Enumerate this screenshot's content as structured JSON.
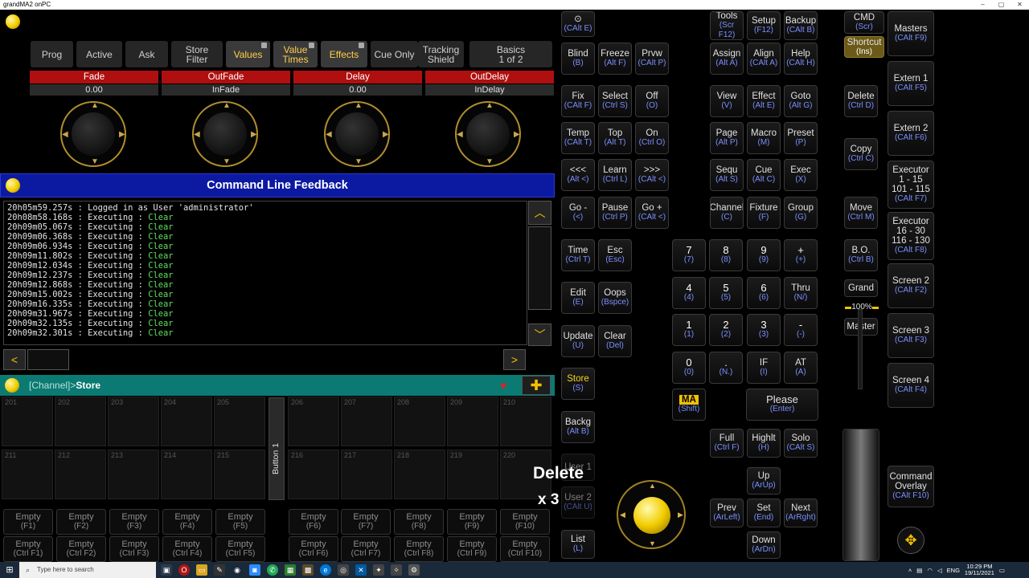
{
  "window": {
    "title": "grandMA2 onPC",
    "minimize": "–",
    "maximize": "▢",
    "close": "✕"
  },
  "toolbar": {
    "tabs": [
      {
        "label": "Prog"
      },
      {
        "label": "Active"
      },
      {
        "label": "Ask"
      },
      {
        "label": "Store Filter"
      },
      {
        "label": "Values"
      },
      {
        "label": "Value Times"
      },
      {
        "label": "Effects"
      },
      {
        "label": "Cue Only"
      },
      {
        "label": "Tracking Shield"
      },
      {
        "label": "Basics 1 of 2"
      }
    ]
  },
  "encoders": [
    {
      "name": "Fade",
      "value": "0.00"
    },
    {
      "name": "OutFade",
      "value": "InFade"
    },
    {
      "name": "Delay",
      "value": "0.00"
    },
    {
      "name": "OutDelay",
      "value": "InDelay"
    }
  ],
  "command_line": {
    "title": "Command Line Feedback",
    "lines": [
      {
        "time": "20h05m59.257s",
        "text": ": Logged in as User 'administrator'",
        "cmd": ""
      },
      {
        "time": "20h08m58.168s",
        "text": ": Executing :",
        "cmd": "Clear"
      },
      {
        "time": "20h09m05.067s",
        "text": ": Executing :",
        "cmd": "Clear"
      },
      {
        "time": "20h09m06.368s",
        "text": ": Executing :",
        "cmd": "Clear"
      },
      {
        "time": "20h09m06.934s",
        "text": ": Executing :",
        "cmd": "Clear"
      },
      {
        "time": "20h09m11.802s",
        "text": ": Executing :",
        "cmd": "Clear"
      },
      {
        "time": "20h09m12.034s",
        "text": ": Executing :",
        "cmd": "Clear"
      },
      {
        "time": "20h09m12.237s",
        "text": ": Executing :",
        "cmd": "Clear"
      },
      {
        "time": "20h09m12.868s",
        "text": ": Executing :",
        "cmd": "Clear"
      },
      {
        "time": "20h09m15.002s",
        "text": ": Executing :",
        "cmd": "Clear"
      },
      {
        "time": "20h09m16.335s",
        "text": ": Executing :",
        "cmd": "Clear"
      },
      {
        "time": "20h09m31.967s",
        "text": ": Executing :",
        "cmd": "Clear"
      },
      {
        "time": "20h09m32.135s",
        "text": ": Executing :",
        "cmd": "Clear"
      },
      {
        "time": "20h09m32.301s",
        "text": ": Executing :",
        "cmd": "Clear"
      }
    ]
  },
  "channel_sheet": {
    "prefix": "[Channel]>",
    "command": "Store",
    "row1": [
      "201",
      "202",
      "203",
      "204",
      "205",
      "206",
      "207",
      "208",
      "209",
      "210"
    ],
    "row2": [
      "211",
      "212",
      "213",
      "214",
      "215",
      "216",
      "217",
      "218",
      "219",
      "220"
    ],
    "side_button": "Button 1"
  },
  "fkeys": {
    "top": [
      {
        "m": "Empty",
        "s": "(F1)"
      },
      {
        "m": "Empty",
        "s": "(F2)"
      },
      {
        "m": "Empty",
        "s": "(F3)"
      },
      {
        "m": "Empty",
        "s": "(F4)"
      },
      {
        "m": "Empty",
        "s": "(F5)"
      },
      {
        "m": "Empty",
        "s": "(F6)"
      },
      {
        "m": "Empty",
        "s": "(F7)"
      },
      {
        "m": "Empty",
        "s": "(F8)"
      },
      {
        "m": "Empty",
        "s": "(F9)"
      },
      {
        "m": "Empty",
        "s": "(F10)"
      }
    ],
    "bottom": [
      {
        "m": "Empty",
        "s": "(Ctrl F1)"
      },
      {
        "m": "Empty",
        "s": "(Ctrl F2)"
      },
      {
        "m": "Empty",
        "s": "(Ctrl F3)"
      },
      {
        "m": "Empty",
        "s": "(Ctrl F4)"
      },
      {
        "m": "Empty",
        "s": "(Ctrl F5)"
      },
      {
        "m": "Empty",
        "s": "(Ctrl F6)"
      },
      {
        "m": "Empty",
        "s": "(Ctrl F7)"
      },
      {
        "m": "Empty",
        "s": "(Ctrl F8)"
      },
      {
        "m": "Empty",
        "s": "(Ctrl F9)"
      },
      {
        "m": "Empty",
        "s": "(Ctrl F10)"
      }
    ]
  },
  "overlay": {
    "key": "Delete",
    "count": "x 3"
  },
  "keys": {
    "cursor": {
      "m": "⊙",
      "s": "(CAlt E)"
    },
    "blind": {
      "m": "Blind",
      "s": "(B)"
    },
    "freeze": {
      "m": "Freeze",
      "s": "(Alt F)"
    },
    "prvw": {
      "m": "Prvw",
      "s": "(CAlt P)"
    },
    "fix": {
      "m": "Fix",
      "s": "(CAlt F)"
    },
    "select": {
      "m": "Select",
      "s": "(Ctrl S)"
    },
    "off": {
      "m": "Off",
      "s": "(O)"
    },
    "temp": {
      "m": "Temp",
      "s": "(CAlt T)"
    },
    "top": {
      "m": "Top",
      "s": "(Alt T)"
    },
    "on": {
      "m": "On",
      "s": "(Ctrl O)"
    },
    "back3": {
      "m": "<<<",
      "s": "(Alt <)"
    },
    "learn": {
      "m": "Learn",
      "s": "(Ctrl L)"
    },
    "fwd3": {
      "m": ">>>",
      "s": "(CAlt <)"
    },
    "gominus": {
      "m": "Go -",
      "s": "(<)"
    },
    "pause": {
      "m": "Pause",
      "s": "(Ctrl P)"
    },
    "goplus": {
      "m": "Go +",
      "s": "(CAlt <)"
    },
    "time": {
      "m": "Time",
      "s": "(Ctrl T)"
    },
    "esc": {
      "m": "Esc",
      "s": "(Esc)"
    },
    "edit": {
      "m": "Edit",
      "s": "(E)"
    },
    "oops": {
      "m": "Oops",
      "s": "(Bspce)"
    },
    "update": {
      "m": "Update",
      "s": "(U)"
    },
    "clear": {
      "m": "Clear",
      "s": "(Del)"
    },
    "store": {
      "m": "Store",
      "s": "(S)"
    },
    "backg": {
      "m": "Backg",
      "s": "(Alt B)"
    },
    "user1": {
      "m": "User 1",
      "s": ""
    },
    "user2": {
      "m": "User 2",
      "s": "(CAlt U)"
    },
    "list": {
      "m": "List",
      "s": "(L)"
    },
    "tools": {
      "m": "Tools",
      "s": "(Scr F12)"
    },
    "setup": {
      "m": "Setup",
      "s": "(F12)"
    },
    "backup": {
      "m": "Backup",
      "s": "(CAlt B)"
    },
    "assign": {
      "m": "Assign",
      "s": "(Alt A)"
    },
    "align": {
      "m": "Align",
      "s": "(CAlt A)"
    },
    "help": {
      "m": "Help",
      "s": "(CAlt H)"
    },
    "view": {
      "m": "View",
      "s": "(V)"
    },
    "effect": {
      "m": "Effect",
      "s": "(Alt E)"
    },
    "goto": {
      "m": "Goto",
      "s": "(Alt G)"
    },
    "page": {
      "m": "Page",
      "s": "(Alt P)"
    },
    "macro": {
      "m": "Macro",
      "s": "(M)"
    },
    "preset": {
      "m": "Preset",
      "s": "(P)"
    },
    "sequ": {
      "m": "Sequ",
      "s": "(Alt S)"
    },
    "cue": {
      "m": "Cue",
      "s": "(Alt C)"
    },
    "exec": {
      "m": "Exec",
      "s": "(X)"
    },
    "channel": {
      "m": "Channel",
      "s": "(C)"
    },
    "fixture": {
      "m": "Fixture",
      "s": "(F)"
    },
    "group": {
      "m": "Group",
      "s": "(G)"
    },
    "n7": {
      "m": "7",
      "s": "(7)"
    },
    "n8": {
      "m": "8",
      "s": "(8)"
    },
    "n9": {
      "m": "9",
      "s": "(9)"
    },
    "plus": {
      "m": "+",
      "s": "(+)"
    },
    "n4": {
      "m": "4",
      "s": "(4)"
    },
    "n5": {
      "m": "5",
      "s": "(5)"
    },
    "n6": {
      "m": "6",
      "s": "(6)"
    },
    "thru": {
      "m": "Thru",
      "s": "(N/)"
    },
    "n1": {
      "m": "1",
      "s": "(1)"
    },
    "n2": {
      "m": "2",
      "s": "(2)"
    },
    "n3": {
      "m": "3",
      "s": "(3)"
    },
    "minus": {
      "m": "-",
      "s": "(-)"
    },
    "n0": {
      "m": "0",
      "s": "(0)"
    },
    "dot": {
      "m": ".",
      "s": "(N.)"
    },
    "if": {
      "m": "IF",
      "s": "(I)"
    },
    "at": {
      "m": "AT",
      "s": "(A)"
    },
    "ma": {
      "m": "MA",
      "s": "(Shift)"
    },
    "please": {
      "m": "Please",
      "s": "(Enter)"
    },
    "full": {
      "m": "Full",
      "s": "(Ctrl F)"
    },
    "highlt": {
      "m": "Highlt",
      "s": "(H)"
    },
    "solo": {
      "m": "Solo",
      "s": "(CAlt S)"
    },
    "up": {
      "m": "Up",
      "s": "(ArUp)"
    },
    "prev": {
      "m": "Prev",
      "s": "(ArLeft)"
    },
    "set": {
      "m": "Set",
      "s": "(End)"
    },
    "next": {
      "m": "Next",
      "s": "(ArRght)"
    },
    "down": {
      "m": "Down",
      "s": "(ArDn)"
    },
    "cmd": {
      "m": "CMD",
      "s": "(Scr)"
    },
    "shortcut": {
      "m": "Shortcut",
      "s": "(Ins)"
    },
    "delete": {
      "m": "Delete",
      "s": "(Ctrl D)"
    },
    "copy": {
      "m": "Copy",
      "s": "(Ctrl C)"
    },
    "move": {
      "m": "Move",
      "s": "(Ctrl M)"
    },
    "bo": {
      "m": "B.O.",
      "s": "(Ctrl B)"
    },
    "grand": {
      "m": "Grand",
      "s": ""
    },
    "grand_level": "100%",
    "master": {
      "m": "Master",
      "s": ""
    },
    "masters": {
      "m": "Masters",
      "s": "(CAlt F9)"
    },
    "extern1": {
      "m": "Extern 1",
      "s": "(CAlt F5)"
    },
    "extern2": {
      "m": "Extern 2",
      "s": "(CAlt F6)"
    },
    "exec1": {
      "m": "Executor",
      "r1": "1 - 15",
      "r2": "101 - 115",
      "s": "(CAlt F7)"
    },
    "exec2": {
      "m": "Executor",
      "r1": "16 - 30",
      "r2": "116 - 130",
      "s": "(CAlt F8)"
    },
    "screen2": {
      "m": "Screen 2",
      "s": "(CAlt F2)"
    },
    "screen3": {
      "m": "Screen 3",
      "s": "(CAlt F3)"
    },
    "screen4": {
      "m": "Screen 4",
      "s": "(CAlt F4)"
    },
    "cmdoverlay": {
      "m": "Command Overlay",
      "s": "(CAlt F10)"
    }
  },
  "taskbar": {
    "search_placeholder": "Type here to search",
    "lang": "ENG",
    "time": "10:29 PM",
    "date": "19/11/2021"
  },
  "colors": {
    "accent_yellow": "#f2cc00",
    "encoder_red": "#b00f0f",
    "feedback_blue": "#0c1aa2",
    "channel_teal": "#0b7a72",
    "shortcut_gold": "#6b5a18"
  }
}
